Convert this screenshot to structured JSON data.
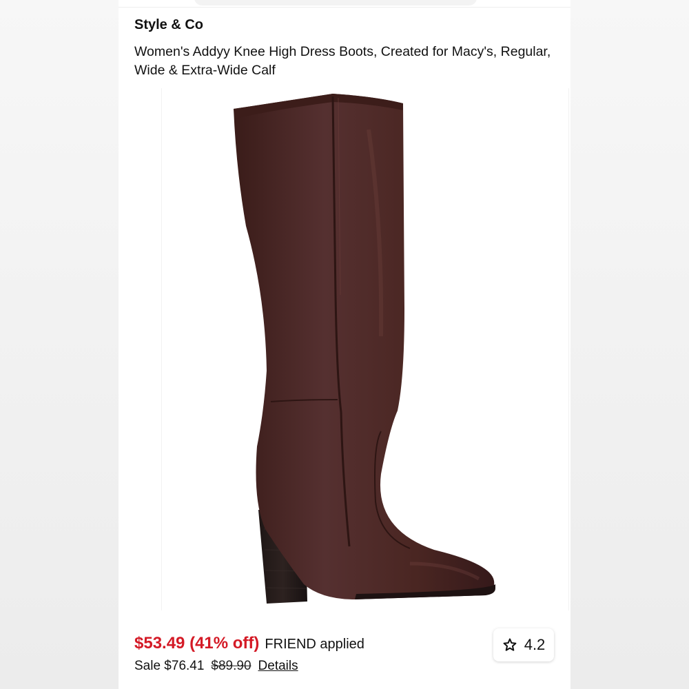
{
  "product": {
    "brand": "Style & Co",
    "title": "Women's Addyy Knee High Dress Boots, Created for Macy's, Regular, Wide & Extra-Wide Calf",
    "image_icon": "knee-high-boot",
    "image_color": "#4a2622"
  },
  "pricing": {
    "current_price": "$53.49 (41% off)",
    "promo_text": "FRIEND applied",
    "sale_label": "Sale $76.41",
    "original_price": "$89.90",
    "details_link": "Details",
    "price_color": "#d41a26"
  },
  "rating": {
    "value": "4.2",
    "icon": "star-icon"
  }
}
